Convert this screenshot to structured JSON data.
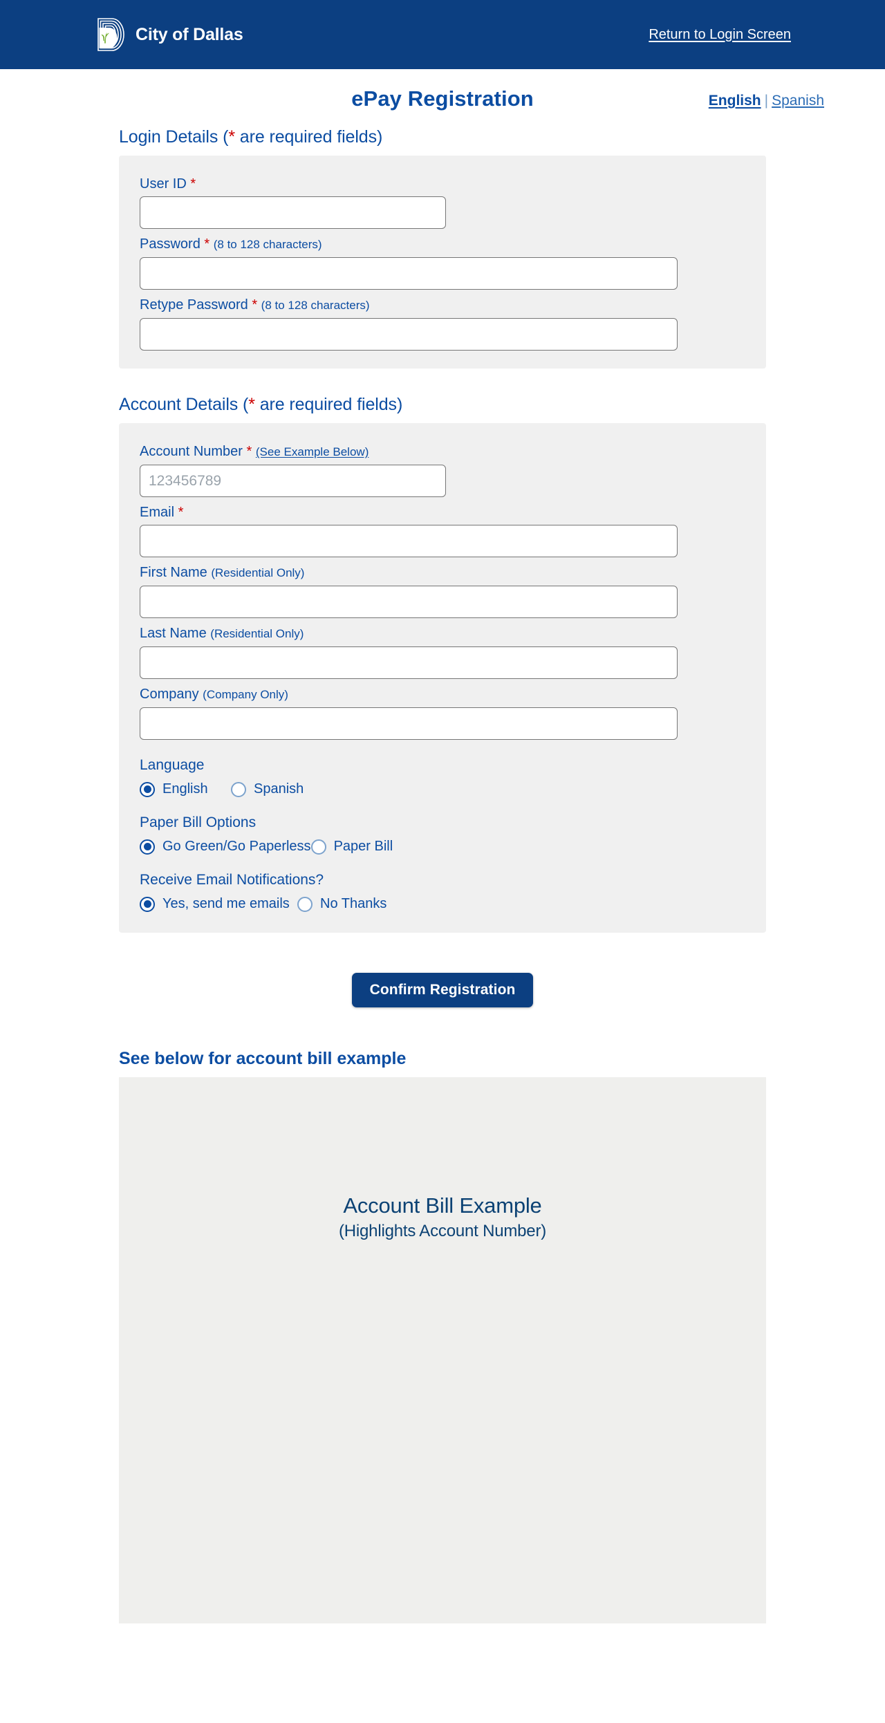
{
  "header": {
    "brand_name": "City of Dallas",
    "logo_icon": "city-of-dallas-logo-icon",
    "return_link": "Return to Login Screen",
    "bar_color": "#0c3f81"
  },
  "page": {
    "title": "ePay Registration",
    "language_switcher": {
      "active": "English",
      "separator": "|",
      "other": "Spanish"
    },
    "accent_color": "#0c4da2",
    "required_color": "#cc0000"
  },
  "login_details": {
    "heading_text": "Login Details (",
    "heading_star": "*",
    "heading_tail": " are required fields)",
    "fields": [
      {
        "label": "User ID",
        "star": "*",
        "hint": "",
        "value": "",
        "placeholder": "",
        "width": "short"
      },
      {
        "label": "Password",
        "star": "*",
        "hint": "(8 to 128 characters)",
        "value": "",
        "placeholder": "",
        "width": "long"
      },
      {
        "label": "Retype Password",
        "star": "*",
        "hint": "(8 to 128 characters)",
        "value": "",
        "placeholder": "",
        "width": "long"
      }
    ]
  },
  "account_details": {
    "heading_text": "Account Details (",
    "heading_star": "*",
    "heading_tail": " are required fields)",
    "account_number": {
      "label": "Account Number",
      "star": "*",
      "link": "(See Example Below)",
      "value": "",
      "placeholder": "123456789"
    },
    "fields": [
      {
        "label": "Email",
        "star": "*",
        "hint": "",
        "value": "",
        "placeholder": "",
        "width": "long"
      },
      {
        "label": "First Name",
        "star": "",
        "hint": "(Residential Only)",
        "value": "",
        "placeholder": "",
        "width": "long"
      },
      {
        "label": "Last Name",
        "star": "",
        "hint": "(Residential Only)",
        "value": "",
        "placeholder": "",
        "width": "long"
      },
      {
        "label": "Company",
        "star": "",
        "hint": "(Company Only)",
        "value": "",
        "placeholder": "",
        "width": "long"
      }
    ],
    "language_group": {
      "label": "Language",
      "options": [
        {
          "label": "English",
          "checked": true
        },
        {
          "label": "Spanish",
          "checked": false
        }
      ]
    },
    "paper_bill_group": {
      "label": "Paper Bill Options",
      "options": [
        {
          "label": "Go Green/Go Paperless",
          "checked": true
        },
        {
          "label": "Paper Bill",
          "checked": false
        }
      ]
    },
    "email_notification_group": {
      "label": "Receive Email Notifications?",
      "options": [
        {
          "label": "Yes, send me emails",
          "checked": true
        },
        {
          "label": "No Thanks",
          "checked": false
        }
      ]
    }
  },
  "submit": {
    "label": "Confirm Registration",
    "color": "#0c3f81"
  },
  "bill_example": {
    "heading": "See below for account bill example",
    "caption_line1": "Account Bill Example",
    "caption_line2": "(Highlights Account Number)"
  }
}
